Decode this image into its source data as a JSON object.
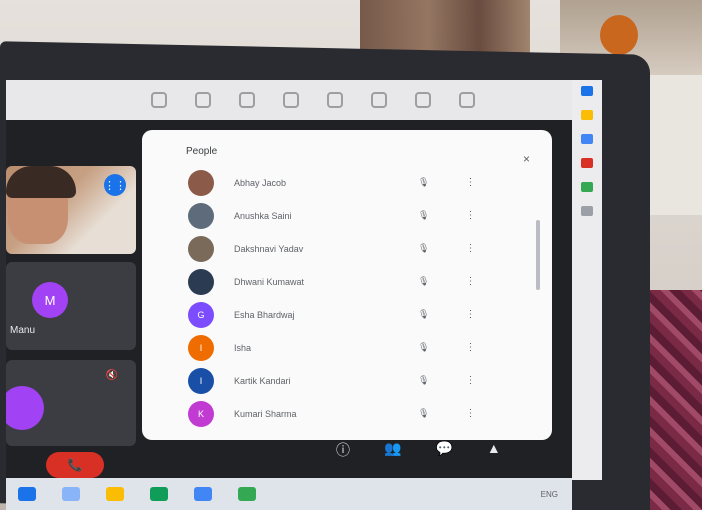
{
  "panel": {
    "title": "People",
    "close_label": "×",
    "participants": [
      {
        "name": "Abhay Jacob",
        "initial": "",
        "color": "#8c5a48",
        "mic": "🎙",
        "more": "⋮"
      },
      {
        "name": "Anushka Saini",
        "initial": "",
        "color": "#5d6b7a",
        "mic": "🎙",
        "more": "⋮"
      },
      {
        "name": "Dakshnavi Yadav",
        "initial": "",
        "color": "#7a6a5a",
        "mic": "🎙",
        "more": "⋮"
      },
      {
        "name": "Dhwani Kumawat",
        "initial": "",
        "color": "#2b3b52",
        "mic": "🎙",
        "more": "⋮"
      },
      {
        "name": "Esha Bhardwaj",
        "initial": "G",
        "color": "#7c4dff",
        "mic": "🎙",
        "more": "⋮"
      },
      {
        "name": "Isha",
        "initial": "I",
        "color": "#ef6c00",
        "mic": "🎙",
        "more": "⋮"
      },
      {
        "name": "Kartik Kandari",
        "initial": "I",
        "color": "#1a4fa8",
        "mic": "🎙",
        "more": "⋮"
      },
      {
        "name": "Kumari Sharma",
        "initial": "K",
        "color": "#c13bd3",
        "mic": "🎙",
        "more": "⋮"
      }
    ]
  },
  "tiles": {
    "video_badge": "⋮⋮",
    "mid_name": "Manu",
    "mid_avatar_initial": "M",
    "low_icon": "🔇"
  },
  "call": {
    "end_label": "📞"
  },
  "controls": [
    "ⓘ",
    "👥",
    "💬",
    "▲"
  ],
  "taskbar": {
    "tray_text": "ENG"
  },
  "colors": {
    "accent": "#1a73e8",
    "end_call": "#d93025",
    "panel_bg": "#fafafa"
  }
}
